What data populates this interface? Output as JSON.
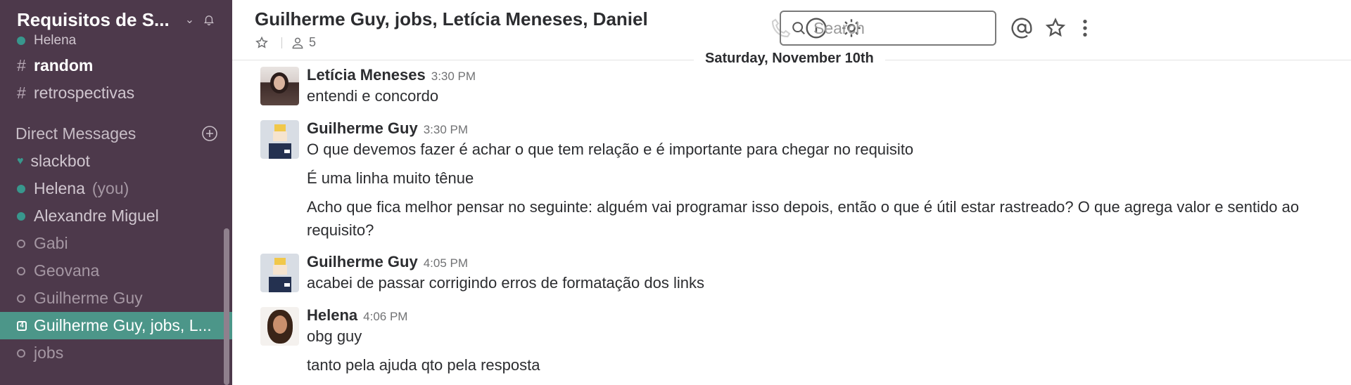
{
  "workspace": {
    "name": "Requisitos de S...",
    "chevron": "chevron-down-icon",
    "bell": "bell-icon"
  },
  "sidebar": {
    "top_items": [
      {
        "label": "Helena",
        "status": "online"
      },
      {
        "label": "random",
        "prefix": "#",
        "bold": true
      },
      {
        "label": "retrospectivas",
        "prefix": "#"
      }
    ],
    "dm_header": "Direct Messages",
    "dms": [
      {
        "label": "slackbot",
        "status": "heart"
      },
      {
        "label": "Helena",
        "you": "(you)",
        "status": "online"
      },
      {
        "label": "Alexandre Miguel",
        "status": "online"
      },
      {
        "label": "Gabi",
        "status": "away"
      },
      {
        "label": "Geovana",
        "status": "away"
      },
      {
        "label": "Guilherme Guy",
        "status": "away"
      },
      {
        "label": "Guilherme Guy, jobs, L...",
        "status": "group",
        "count": "4",
        "active": true
      },
      {
        "label": "jobs",
        "status": "away"
      }
    ]
  },
  "header": {
    "title": "Guilherme Guy, jobs, Letícia Meneses, Daniel",
    "members": "5",
    "search_placeholder": "Search"
  },
  "date_divider": "Saturday, November 10th",
  "messages": [
    {
      "sender": "Letícia Meneses",
      "time": "3:30 PM",
      "lines": [
        "entendi e concordo"
      ]
    },
    {
      "sender": "Guilherme Guy",
      "time": "3:30 PM",
      "lines": [
        "O que devemos fazer é achar o que tem relação e é importante para chegar no requisito",
        "É uma linha muito tênue",
        "Acho que fica melhor pensar no seguinte: alguém vai programar isso depois, então o que é útil estar rastreado? O que agrega valor e sentido ao requisito?"
      ]
    },
    {
      "sender": "Guilherme Guy",
      "time": "4:05 PM",
      "lines": [
        "acabei de passar corrigindo erros de formatação dos links"
      ]
    },
    {
      "sender": "Helena",
      "time": "4:06 PM",
      "lines": [
        "obg guy",
        "tanto pela ajuda qto pela resposta"
      ]
    }
  ],
  "colors": {
    "sidebar_bg": "#4d394b",
    "active_bg": "#4c9689",
    "online": "#38978d"
  }
}
